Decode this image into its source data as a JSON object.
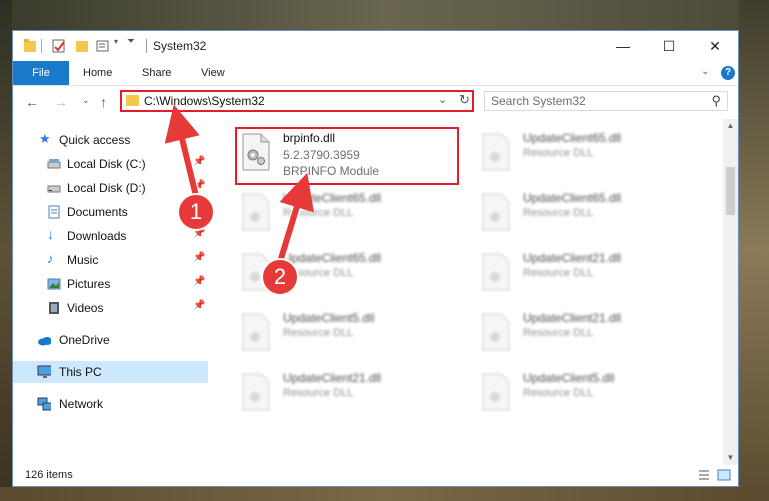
{
  "window": {
    "title": "System32"
  },
  "ribbon": {
    "tabs": [
      "File",
      "Home",
      "Share",
      "View"
    ]
  },
  "address": {
    "path": "C:\\Windows\\System32"
  },
  "search": {
    "placeholder": "Search System32"
  },
  "nav_pane": {
    "items": [
      {
        "label": "Quick access",
        "icon": "star-icon"
      },
      {
        "label": "Local Disk (C:)",
        "icon": "drive-icon"
      },
      {
        "label": "Local Disk (D:)",
        "icon": "drive-icon"
      },
      {
        "label": "Documents",
        "icon": "documents-icon"
      },
      {
        "label": "Downloads",
        "icon": "downloads-icon"
      },
      {
        "label": "Music",
        "icon": "music-icon"
      },
      {
        "label": "Pictures",
        "icon": "pictures-icon"
      },
      {
        "label": "Videos",
        "icon": "videos-icon"
      },
      {
        "label": "OneDrive",
        "icon": "onedrive-icon"
      },
      {
        "label": "This PC",
        "icon": "this-pc-icon"
      },
      {
        "label": "Network",
        "icon": "network-icon"
      }
    ]
  },
  "files": {
    "main": {
      "name": "brpinfo.dll",
      "version": "5.2.3790.3959",
      "description": "BRPINFO Module"
    },
    "left_col": [
      {
        "name": "UpdateClient65.dll",
        "type": "Resource DLL"
      },
      {
        "name": "UpdateClient65.dll",
        "type": "Resource DLL"
      },
      {
        "name": "UpdateClient5.dll",
        "type": "Resource DLL"
      },
      {
        "name": "UpdateClient21.dll",
        "type": "Resource DLL"
      }
    ],
    "right_col": [
      {
        "name": "UpdateClient65.dll",
        "type": "Resource DLL"
      },
      {
        "name": "UpdateClient65.dll",
        "type": "Resource DLL"
      },
      {
        "name": "UpdateClient21.dll",
        "type": "Resource DLL"
      },
      {
        "name": "UpdateClient21.dll",
        "type": "Resource DLL"
      },
      {
        "name": "UpdateClient5.dll",
        "type": "Resource DLL"
      }
    ]
  },
  "status": {
    "item_count": "126 items"
  },
  "annotations": {
    "step1": "1",
    "step2": "2"
  },
  "colors": {
    "accent": "#1979ca",
    "highlight": "#e11d2b",
    "badge": "#e53a38",
    "selected": "#cce8ff"
  }
}
